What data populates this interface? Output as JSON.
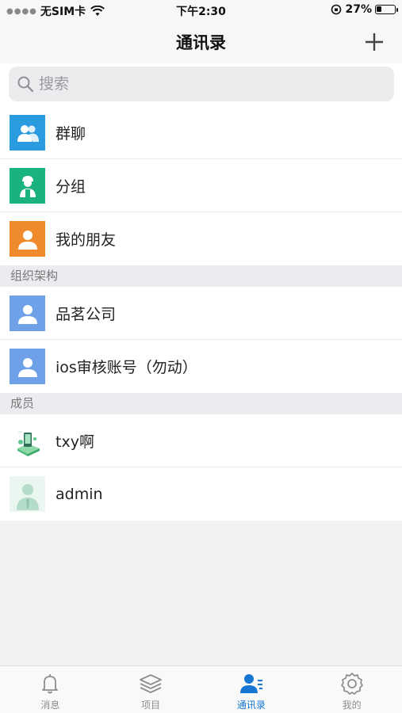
{
  "status_bar": {
    "carrier": "无SIM卡",
    "time": "下午2:30",
    "battery_text": "27%",
    "battery_level": 0.27
  },
  "nav": {
    "title": "通讯录"
  },
  "search": {
    "placeholder": "搜索"
  },
  "top_items": [
    {
      "label": "群聊",
      "icon": "group-chat-icon",
      "color": "#2b9be0"
    },
    {
      "label": "分组",
      "icon": "group-icon",
      "color": "#1ab37e"
    },
    {
      "label": "我的朋友",
      "icon": "friend-icon",
      "color": "#ef8b2c"
    }
  ],
  "sections": {
    "org": "组织架构",
    "members": "成员"
  },
  "org_items": [
    {
      "label": "品茗公司",
      "icon": "org-icon",
      "color": "#6fa1e8"
    },
    {
      "label": "ios审核账号（勿动）",
      "icon": "org-icon",
      "color": "#6fa1e8"
    }
  ],
  "member_items": [
    {
      "label": "txy啊",
      "icon": "member-photo-icon"
    },
    {
      "label": "admin",
      "icon": "default-avatar-icon",
      "color": "#b4dccb"
    }
  ],
  "tabs": [
    {
      "label": "消息",
      "icon": "bell-icon",
      "active": false
    },
    {
      "label": "项目",
      "icon": "layers-icon",
      "active": false
    },
    {
      "label": "通讯录",
      "icon": "contacts-icon",
      "active": true
    },
    {
      "label": "我的",
      "icon": "gear-icon",
      "active": false
    }
  ],
  "colors": {
    "accent": "#1677d2"
  }
}
